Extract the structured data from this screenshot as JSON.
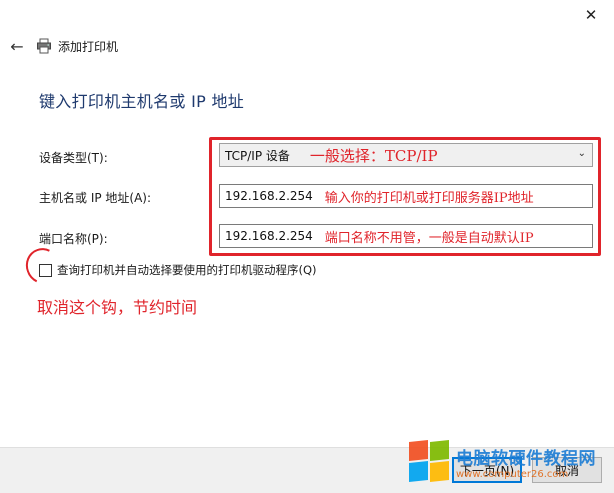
{
  "window": {
    "close_glyph": "✕",
    "back_glyph": "←",
    "title": "添加打印机"
  },
  "page": {
    "heading": "键入打印机主机名或 IP 地址"
  },
  "form": {
    "device_type": {
      "label": "设备类型(T):",
      "value": "TCP/IP 设备",
      "note": "一般选择：TCP/IP"
    },
    "hostname": {
      "label": "主机名或 IP 地址(A):",
      "value": "192.168.2.254",
      "note": "输入你的打印机或打印服务器IP地址"
    },
    "port_name": {
      "label": "端口名称(P):",
      "value": "192.168.2.254",
      "note": "端口名称不用管，一般是自动默认IP"
    },
    "query_checkbox": {
      "label": "查询打印机并自动选择要使用的打印机驱动程序(Q)",
      "checked": false
    }
  },
  "annotation": {
    "text": "取消这个钩，节约时间"
  },
  "footer": {
    "next_label": "下一页(N)",
    "cancel_label": "取消"
  },
  "watermark": {
    "title": "电脑软硬件教程网",
    "url": "www.computer26.com"
  },
  "colors": {
    "annotation_red": "#e0242b",
    "heading_blue": "#1f3a6e",
    "focus_blue": "#0078d7"
  },
  "icons": {
    "close": "close-icon",
    "back": "back-arrow-icon",
    "printer": "printer-icon",
    "dropdown": "chevron-down-icon",
    "logo": "windows-logo-icon"
  }
}
